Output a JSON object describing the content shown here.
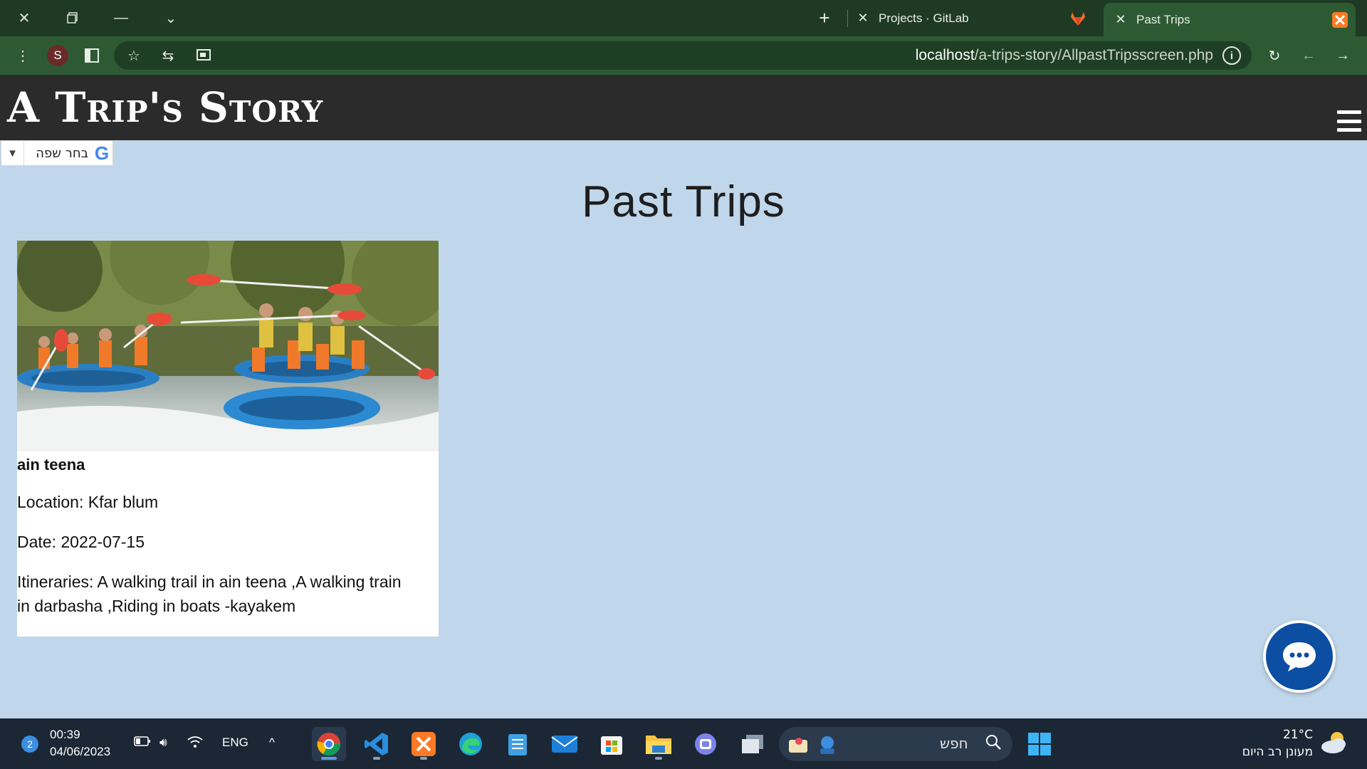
{
  "browser": {
    "tabs": [
      {
        "title": "Projects · GitLab",
        "active": false
      },
      {
        "title": "Past Trips",
        "active": true
      }
    ],
    "profile_initial": "S",
    "url_host": "localhost",
    "url_path": "/a-trips-story/AllpastTripsscreen.php"
  },
  "site": {
    "logo": "A Trip's Story",
    "translate_label": "בחר שפה",
    "page_title": "Past Trips"
  },
  "trips": [
    {
      "name": "ain teena",
      "location": "Location: Kfar blum",
      "date": "Date: 2022-07-15",
      "itineraries": "Itineraries: A walking trail in ain teena ,A walking train in darbasha ,Riding in boats -kayakem"
    }
  ],
  "taskbar": {
    "notification_count": "2",
    "time": "00:39",
    "date": "04/06/2023",
    "language": "ENG",
    "search_placeholder": "חפש",
    "temperature": "21°C",
    "weather_text": "מעונן רב היום"
  },
  "colors": {
    "tab_bar": "#1f3a23",
    "toolbar": "#2d5a33",
    "page_background": "#c0d6ea",
    "site_header": "#2b2b2b",
    "chat_button": "#0b4ea2"
  }
}
